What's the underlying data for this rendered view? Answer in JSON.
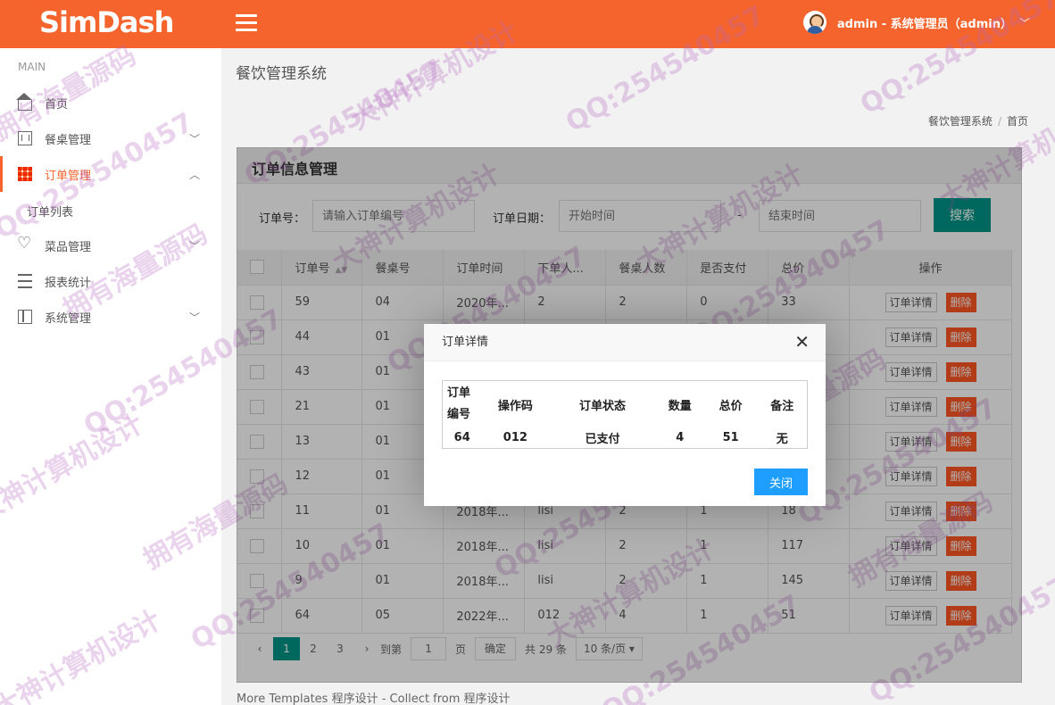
{
  "header": {
    "logo": "SimDash",
    "user": "admin - 系统管理员（admin）",
    "chevron": "﹀"
  },
  "sidebar": {
    "section": "MAIN",
    "items": [
      {
        "label": "首页",
        "icon": "home-icon",
        "arrow": ""
      },
      {
        "label": "餐桌管理",
        "icon": "table-icon",
        "arrow": "﹀"
      },
      {
        "label": "订单管理",
        "icon": "grid-icon",
        "arrow": "︿"
      },
      {
        "label": "菜品管理",
        "icon": "heart-icon",
        "arrow": "﹀"
      },
      {
        "label": "报表统计",
        "icon": "list-icon",
        "arrow": ""
      },
      {
        "label": "系统管理",
        "icon": "layout-icon",
        "arrow": "﹀"
      }
    ],
    "sub": "订单列表"
  },
  "page": {
    "title": "餐饮管理系统",
    "crumb1": "餐饮管理系统",
    "crumb2": "首页"
  },
  "panel": {
    "title": "订单信息管理",
    "order_no_label": "订单号：",
    "order_no_placeholder": "请输入订单编号",
    "date_label": "订单日期：",
    "start_placeholder": "开始时间",
    "dash": "-",
    "end_placeholder": "结束时间",
    "search_btn": "搜索"
  },
  "table": {
    "headers": [
      "订单号",
      "餐桌号",
      "订单时间",
      "下单人...",
      "餐桌人数",
      "是否支付",
      "总价",
      "操作"
    ],
    "detail_btn": "订单详情",
    "delete_btn": "删除",
    "rows": [
      [
        "59",
        "04",
        "2020年...",
        "2",
        "2",
        "0",
        "33"
      ],
      [
        "44",
        "01",
        "",
        "",
        "",
        "",
        ""
      ],
      [
        "43",
        "01",
        "",
        "",
        "",
        "",
        ""
      ],
      [
        "21",
        "01",
        "",
        "",
        "",
        "",
        ""
      ],
      [
        "13",
        "01",
        "",
        "",
        "",
        "",
        ""
      ],
      [
        "12",
        "01",
        "",
        "",
        "",
        "",
        ""
      ],
      [
        "11",
        "01",
        "2018年...",
        "lisi",
        "2",
        "1",
        "18"
      ],
      [
        "10",
        "01",
        "2018年...",
        "lisi",
        "2",
        "1",
        "117"
      ],
      [
        "9",
        "01",
        "2018年...",
        "lisi",
        "2",
        "1",
        "145"
      ],
      [
        "64",
        "05",
        "2022年...",
        "012",
        "4",
        "1",
        "51"
      ]
    ]
  },
  "pager": {
    "prev": "‹",
    "pages": [
      "1",
      "2",
      "3"
    ],
    "next": "›",
    "goto_label": "到第",
    "goto_value": "1",
    "page_unit": "页",
    "confirm": "确定",
    "total": "共 29 条",
    "per_page": "10 条/页 ▾"
  },
  "footer": "More Templates 程序设计 - Collect from 程序设计",
  "modal": {
    "title": "订单详情",
    "close": "✕",
    "headers": [
      "订单编号",
      "操作码",
      "订单状态",
      "数量",
      "总价",
      "备注"
    ],
    "values": [
      "64",
      "012",
      "已支付",
      "4",
      "51",
      "无"
    ],
    "button": "关闭"
  },
  "watermarks": [
    "QQ:254540457",
    "大神计算机设计",
    "拥有海量源码"
  ]
}
